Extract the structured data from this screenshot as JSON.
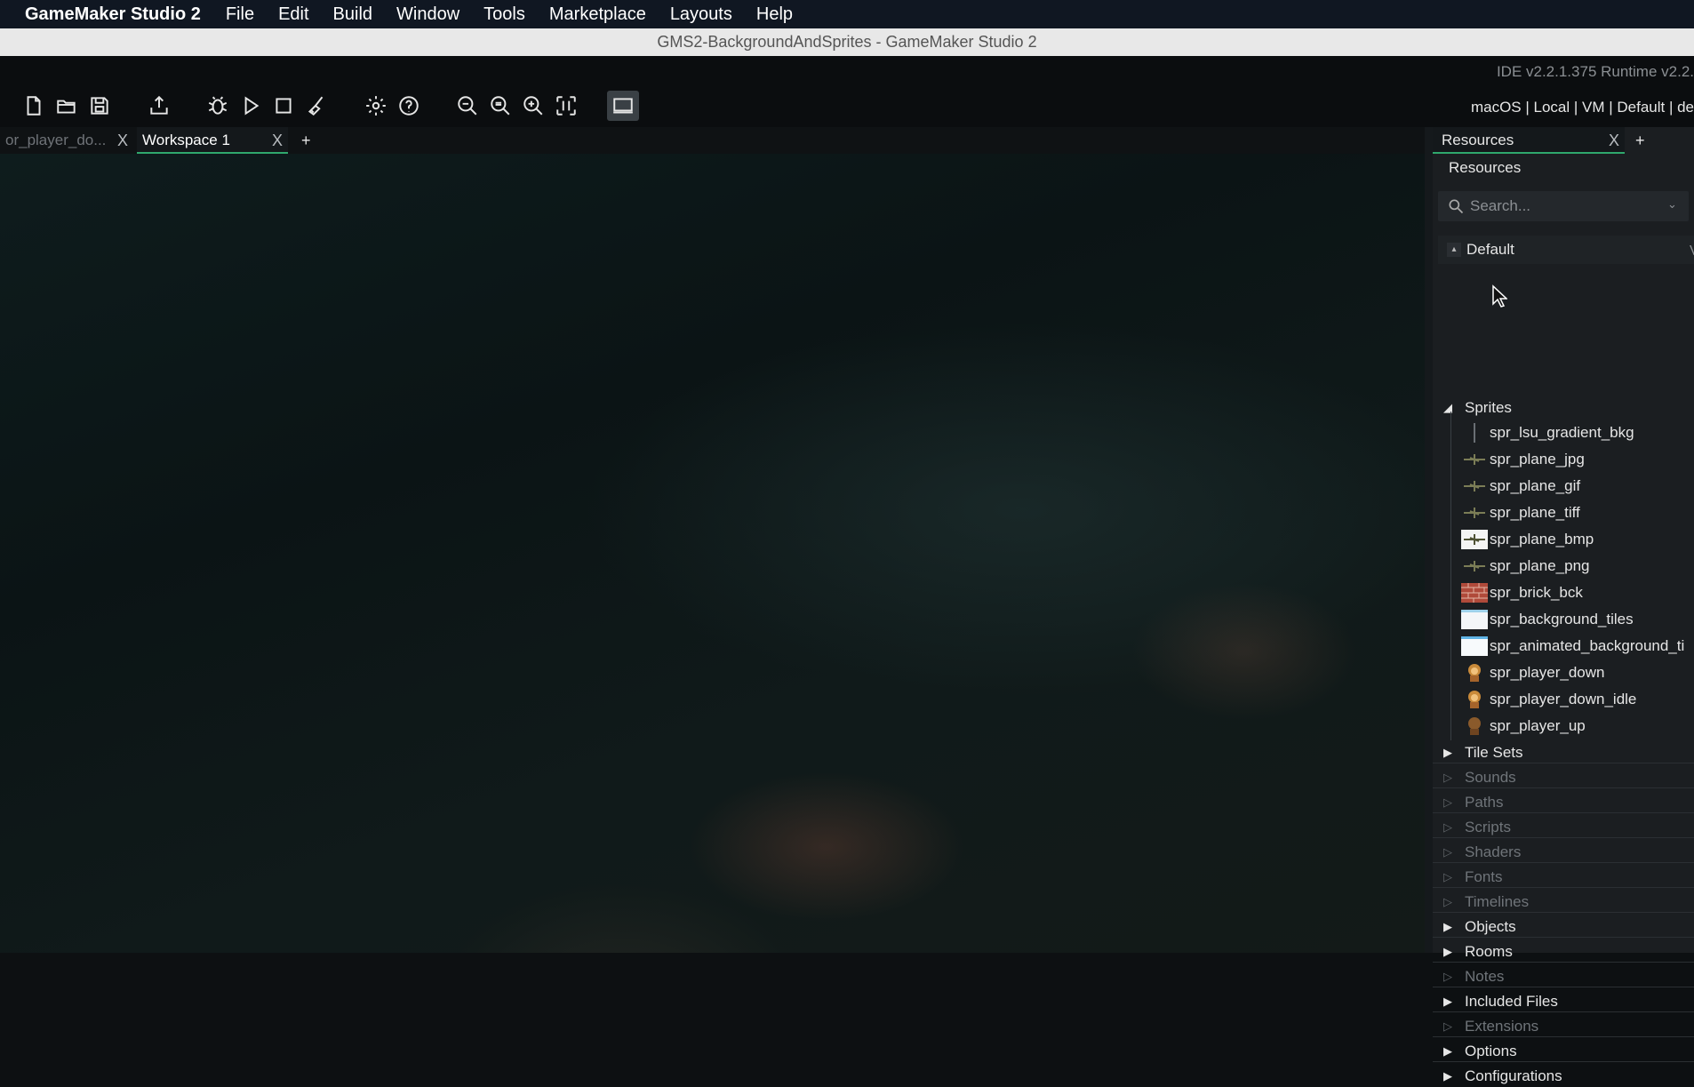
{
  "menubar": {
    "app_name": "GameMaker Studio 2",
    "items": [
      "File",
      "Edit",
      "Build",
      "Window",
      "Tools",
      "Marketplace",
      "Layouts",
      "Help"
    ]
  },
  "window": {
    "title": "GMS2-BackgroundAndSprites - GameMaker Studio 2",
    "version": "IDE v2.2.1.375  Runtime v2.2.",
    "target": "macOS | Local | VM | Default | de"
  },
  "toolbar": {
    "icons": [
      "new-project-icon",
      "open-project-icon",
      "save-project-icon",
      "create-executable-icon",
      "debug-icon",
      "run-icon",
      "stop-icon",
      "clean-icon",
      "game-options-icon",
      "help-icon",
      "zoom-out-icon",
      "zoom-reset-icon",
      "zoom-in-icon",
      "fit-to-window-icon",
      "target-device-icon"
    ]
  },
  "tabs": [
    {
      "label": "or_player_do...",
      "active": false
    },
    {
      "label": "Workspace 1",
      "active": true
    }
  ],
  "tab_close": "X",
  "tab_add": "+",
  "resources": {
    "tab_label": "Resources",
    "title": "Resources",
    "search_placeholder": "Search...",
    "filter": "Default",
    "filter_suffix": "V",
    "sprites_label": "Sprites",
    "sprites": [
      "spr_lsu_gradient_bkg",
      "spr_plane_jpg",
      "spr_plane_gif",
      "spr_plane_tiff",
      "spr_plane_bmp",
      "spr_plane_png",
      "spr_brick_bck",
      "spr_background_tiles",
      "spr_animated_background_ti",
      "spr_player_down",
      "spr_player_down_idle",
      "spr_player_up"
    ],
    "categories": [
      {
        "label": "Tile Sets",
        "enabled": true
      },
      {
        "label": "Sounds",
        "enabled": false
      },
      {
        "label": "Paths",
        "enabled": false
      },
      {
        "label": "Scripts",
        "enabled": false
      },
      {
        "label": "Shaders",
        "enabled": false
      },
      {
        "label": "Fonts",
        "enabled": false
      },
      {
        "label": "Timelines",
        "enabled": false
      },
      {
        "label": "Objects",
        "enabled": true
      },
      {
        "label": "Rooms",
        "enabled": true
      },
      {
        "label": "Notes",
        "enabled": false
      },
      {
        "label": "Included Files",
        "enabled": true
      },
      {
        "label": "Extensions",
        "enabled": false
      },
      {
        "label": "Options",
        "enabled": true
      },
      {
        "label": "Configurations",
        "enabled": true
      }
    ]
  },
  "colors": {
    "accent": "#2fa86d",
    "menubar_bg": "#101722",
    "panel_bg": "#1b1e21"
  }
}
